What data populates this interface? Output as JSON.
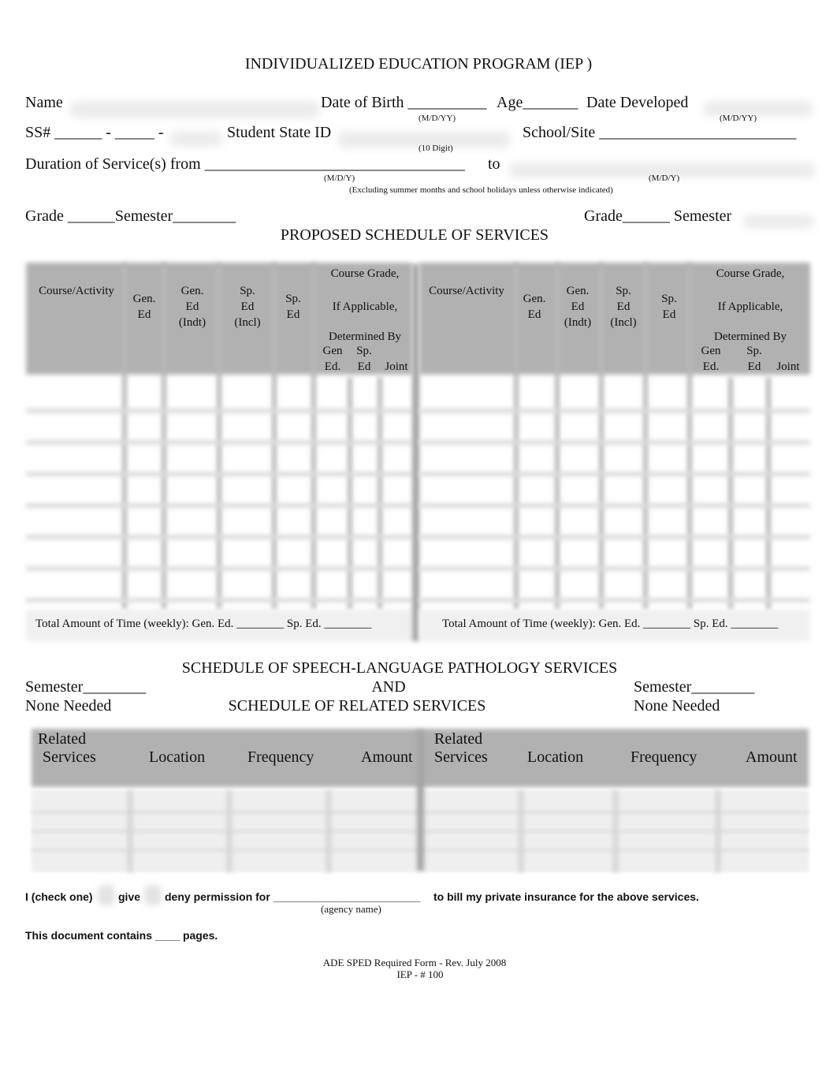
{
  "document": {
    "title": "INDIVIDUALIZED EDUCATION PROGRAM (IEP  )"
  },
  "header_fields": {
    "name_label": "Name",
    "dob_label": "Date of Birth __________",
    "age_label": "Age_______",
    "date_developed_label": "Date Developed",
    "dob_hint": "(M/D/YY)",
    "date_developed_hint": "(M/D/YY)",
    "ss_label": "SS# ______ - _____ -",
    "student_state_id_label": "Student State ID",
    "student_state_id_hint": "(10 Digit)",
    "school_site_label": "School/Site _________________________",
    "duration_label": "Duration of Service(s) from _________________________________",
    "duration_to_label": "to",
    "duration_from_hint": "(M/D/Y)",
    "duration_to_hint": "(M/D/Y)",
    "duration_note": "(Excluding summer months and school holidays unless otherwise indicated)"
  },
  "grade_semester": {
    "left": "Grade ______Semester________",
    "right_grade": "Grade______ Semester"
  },
  "proposed_schedule": {
    "title": "PROPOSED SCHEDULE OF SERVICES",
    "columns": [
      {
        "key": "course",
        "lines": [
          "Course/Activity"
        ]
      },
      {
        "key": "gen_ed",
        "lines": [
          "Gen.",
          "Ed"
        ]
      },
      {
        "key": "gen_ed_indt",
        "lines": [
          "Gen.",
          "Ed",
          "(Indt)"
        ]
      },
      {
        "key": "sp_ed_incl",
        "lines": [
          "Sp.",
          "Ed",
          "(Incl)"
        ]
      },
      {
        "key": "sp_ed",
        "lines": [
          "Sp.",
          "Ed"
        ]
      }
    ],
    "course_grade_header": {
      "line1": "Course Grade,",
      "line2": "If Applicable,",
      "line3": "Determined By",
      "sub_gen_top": "Gen",
      "sub_gen_bottom": "Ed.",
      "sub_sp_top": "Sp.",
      "sub_sp_bottom": "Ed",
      "sub_joint": "Joint"
    },
    "row_count": 8,
    "total_left": "Total Amount of Time (weekly): Gen. Ed. ________ Sp. Ed. ________",
    "total_right": "Total Amount of Time (weekly): Gen. Ed. ________ Sp. Ed. ________"
  },
  "related_services": {
    "title_line1": "SCHEDULE OF SPEECH-LANGUAGE PATHOLOGY SERVICES",
    "title_line2": "AND",
    "title_line3": "SCHEDULE OF RELATED SERVICES",
    "left_semester": "Semester________",
    "left_none_needed": "None Needed",
    "right_semester": "Semester________",
    "right_none_needed": "None Needed",
    "columns": {
      "related_top": "Related",
      "related_bottom": "Services",
      "location": "Location",
      "frequency": "Frequency",
      "amount": "Amount"
    },
    "row_count": 4
  },
  "permission": {
    "prefix": "I (check one)",
    "give": "give",
    "deny": "deny permission for ________________________",
    "suffix": "to bill my private insurance for the above services.",
    "agency_hint": "(agency name)"
  },
  "pages_line": "This document contains ____ pages.",
  "footer": {
    "line1": "ADE SPED Required Form - Rev. July 2008",
    "line2": "IEP - # 100"
  }
}
